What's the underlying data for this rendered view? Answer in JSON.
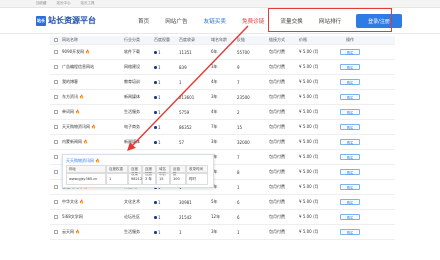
{
  "topbar": [
    "加收藏",
    "站长中心",
    "站长工具"
  ],
  "logo": {
    "badge": "站长",
    "text": "站长资源平台"
  },
  "nav": [
    {
      "label": "首页",
      "state": "normal"
    },
    {
      "label": "网站广告",
      "state": "normal"
    },
    {
      "label": "友链买卖",
      "state": "active"
    },
    {
      "label": "免费诊链",
      "state": "hl"
    },
    {
      "label": "流量交换",
      "state": "normal"
    },
    {
      "label": "网站排行",
      "state": "normal"
    }
  ],
  "login_button": "登录/注册",
  "headers": [
    "网站名称",
    "行业分类",
    "百度权重",
    "百度收录",
    "域名年龄",
    "反链",
    "链接方式",
    "价格",
    "操作"
  ],
  "rows": [
    {
      "name": "9090开发网",
      "fire": true,
      "cat": "软件下载",
      "br": "1",
      "n1": "11351",
      "age": "6年",
      "back": "55700",
      "method": "包月付费",
      "price": "¥ 5.00 /月",
      "buy": "购买"
    },
    {
      "name": "广告编程信息网站",
      "fire": false,
      "cat": "网络建设",
      "br": "1",
      "n1": "839",
      "age": "3年",
      "back": "9",
      "method": "包月付费",
      "price": "¥ 5.00 /月",
      "buy": "购买"
    },
    {
      "name": "我的博客",
      "fire": false,
      "cat": "教育培训",
      "br": "1",
      "n1": "1",
      "age": "4年",
      "back": "7",
      "method": "包月付费",
      "price": "¥ 5.00 /月",
      "buy": "购买"
    },
    {
      "name": "东方资讯",
      "fire": true,
      "cat": "新闻媒体",
      "br": "1",
      "n1": "213601",
      "age": "3年",
      "back": "23500",
      "method": "包月付费",
      "price": "¥ 5.00 /月",
      "buy": "购买"
    },
    {
      "name": "单词网",
      "fire": true,
      "cat": "生活服务",
      "br": "1",
      "n1": "5759",
      "age": "4年",
      "back": "2",
      "method": "包月付费",
      "price": "¥ 5.00 /月",
      "buy": "购买"
    },
    {
      "name": "天天购物资讯网",
      "fire": true,
      "cat": "电子商务",
      "br": "1",
      "n1": "86352",
      "age": "7年",
      "back": "15",
      "method": "包月付费",
      "price": "¥ 5.00 /月",
      "buy": "购买"
    },
    {
      "name": "内蒙新闻网",
      "fire": true,
      "cat": "新闻媒体",
      "br": "1",
      "n1": "57",
      "age": "3年",
      "back": "32000",
      "method": "包月付费",
      "price": "¥ 5.00 /月",
      "buy": "购买"
    },
    {
      "name": "中国表情网",
      "fire": false,
      "cat": "生活服务",
      "br": "1",
      "n1": "1172",
      "age": "2年",
      "back": "7",
      "method": "包月付费",
      "price": "¥ 5.00 /月",
      "buy": "购买"
    },
    {
      "name": "健康之家",
      "fire": false,
      "cat": "医疗健康",
      "br": "1",
      "n1": "1125",
      "age": "3年",
      "back": "8",
      "method": "包月付费",
      "price": "¥ 5.00 /月",
      "buy": "购买"
    },
    {
      "name": "金融时代网",
      "fire": true,
      "cat": "行业门户",
      "br": "1",
      "n1": "1",
      "age": "4年",
      "back": "1",
      "method": "包月付费",
      "price": "¥ 5.00 /月",
      "buy": "购买"
    },
    {
      "name": "中华文化",
      "fire": true,
      "cat": "文化艺术",
      "br": "1",
      "n1": "30981",
      "age": "5年",
      "back": "6",
      "method": "包月付费",
      "price": "¥ 5.00 /月",
      "buy": "购买"
    },
    {
      "name": "5i68文学网",
      "fire": false,
      "cat": "论坛社区",
      "br": "1",
      "n1": "21542",
      "age": "12年",
      "back": "6",
      "method": "包月付费",
      "price": "¥ 5.00 /月",
      "buy": "购买"
    },
    {
      "name": "云天网",
      "fire": true,
      "cat": "生活服务",
      "br": "1",
      "n1": "1",
      "age": "3年",
      "back": "1",
      "method": "包月付费",
      "price": "¥ 5.00 /月",
      "buy": "购买"
    }
  ],
  "popup": {
    "title": "天天购物资讯网",
    "headers": [
      "网址",
      "百度权重",
      "百度收录",
      "百度快照",
      "域名年龄",
      "反链数",
      "收录时间"
    ],
    "values": [
      "www.gjsy365.cn",
      "1",
      "98212",
      "3 年",
      "15",
      "100",
      "时时"
    ]
  }
}
